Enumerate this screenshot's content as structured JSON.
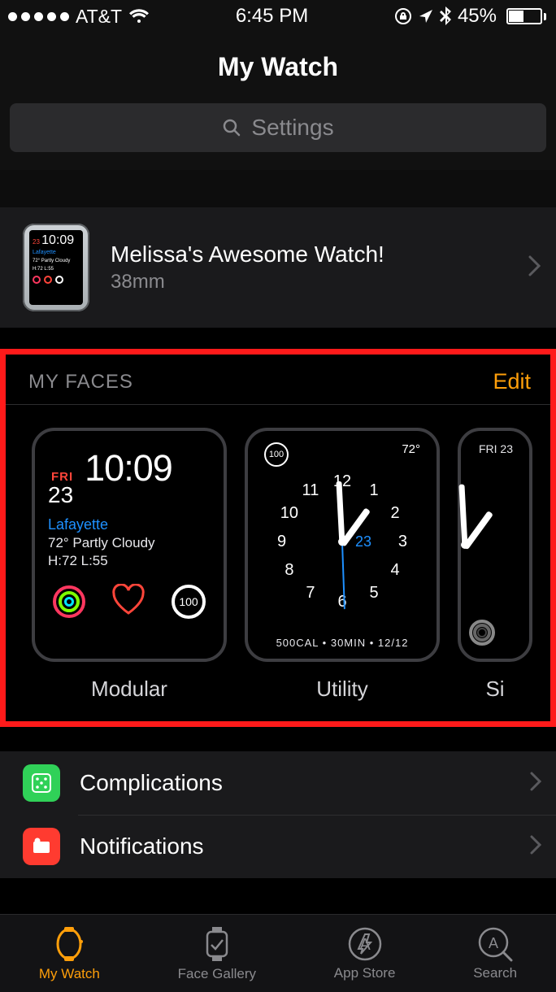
{
  "status": {
    "carrier": "AT&T",
    "time": "6:45 PM",
    "battery_pct": "45%"
  },
  "nav": {
    "title": "My Watch"
  },
  "search": {
    "placeholder": "Settings"
  },
  "device": {
    "name": "Melissa's Awesome Watch!",
    "size": "38mm",
    "thumb": {
      "day": "23",
      "time": "10:09",
      "wx": "72° Partly Cloudy",
      "hl": "H:72 L:55"
    }
  },
  "faces": {
    "header": "MY FACES",
    "edit": "Edit",
    "items": [
      {
        "label": "Modular",
        "fri": "FRI",
        "date": "23",
        "time": "10:09",
        "city": "Lafayette",
        "wx": "72° Partly Cloudy",
        "hl": "H:72 L:55",
        "badge": "100"
      },
      {
        "label": "Utility",
        "corner_badge": "100",
        "temp": "72°",
        "center_date": "23",
        "bottom": "500CAL • 30MIN • 12/12"
      },
      {
        "label": "Si",
        "top": "FRI 23"
      }
    ]
  },
  "settings_rows": {
    "complications": "Complications",
    "notifications": "Notifications"
  },
  "tabs": {
    "my_watch": "My Watch",
    "face_gallery": "Face Gallery",
    "app_store": "App Store",
    "search": "Search"
  }
}
